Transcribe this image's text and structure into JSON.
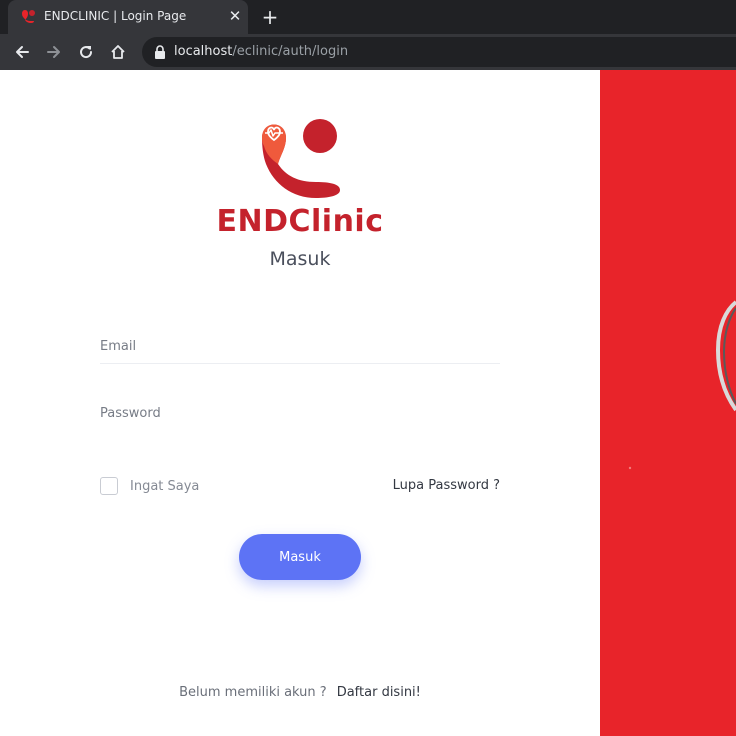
{
  "browser": {
    "tab_title": "ENDCLINIC | Login Page",
    "tab_close": "✕",
    "new_tab": "+",
    "url_host": "localhost",
    "url_path": "/eclinic/auth/login"
  },
  "login": {
    "brand": "ENDClinic",
    "subtitle": "Masuk",
    "email_placeholder": "Email",
    "password_placeholder": "Password",
    "remember_label": "Ingat Saya",
    "forgot_link": "Lupa Password ?",
    "submit_label": "Masuk",
    "no_account_text": "Belum memiliki akun ?",
    "register_link": "Daftar disini!"
  },
  "colors": {
    "brand_red": "#c4222c",
    "button_blue": "#5d73f5",
    "panel_red": "#e8242a"
  },
  "icons": [
    "clinic-logo-icon",
    "back-arrow-icon",
    "forward-arrow-icon",
    "reload-icon",
    "home-icon",
    "lock-icon",
    "close-icon",
    "plus-icon"
  ]
}
